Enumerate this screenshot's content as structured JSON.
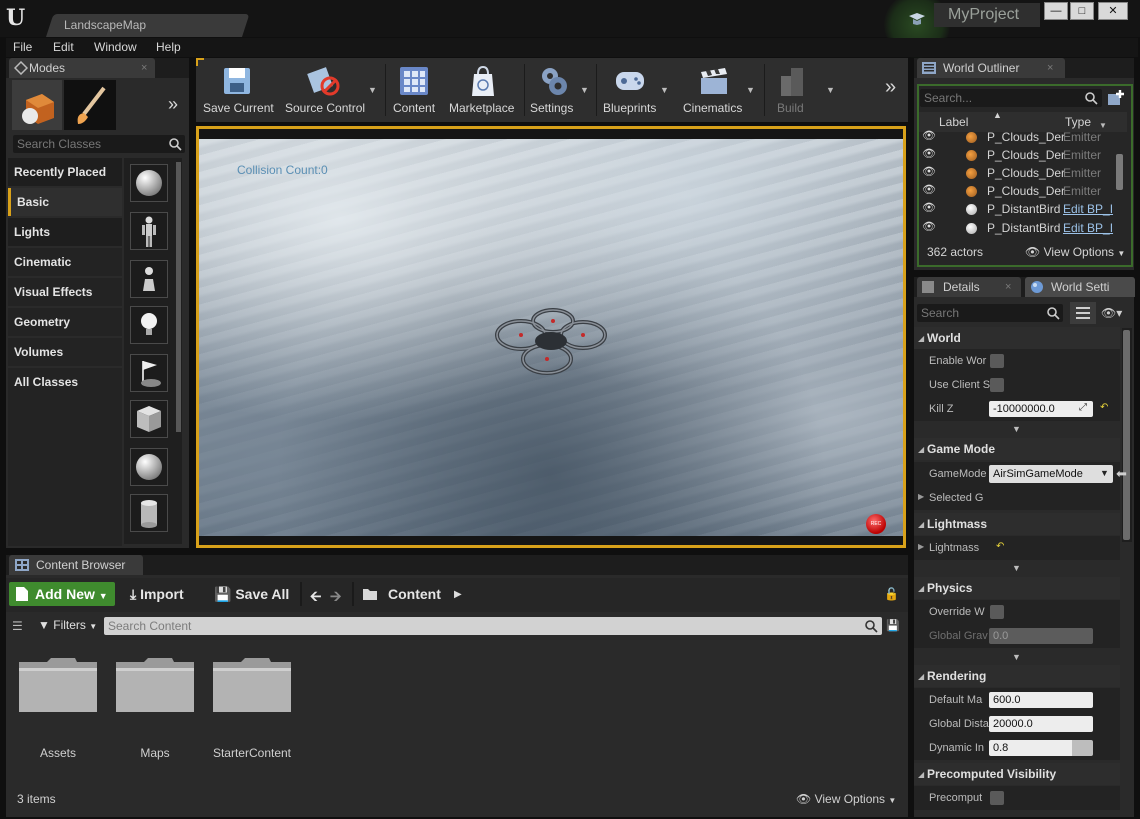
{
  "window": {
    "map_tab": "LandscapeMap",
    "project_name": "MyProject",
    "controls": [
      "minimize",
      "maximize",
      "close"
    ]
  },
  "menu": [
    "File",
    "Edit",
    "Window",
    "Help"
  ],
  "modes": {
    "title": "Modes",
    "search_placeholder": "Search Classes",
    "categories": [
      "Recently Placed",
      "Basic",
      "Lights",
      "Cinematic",
      "Visual Effects",
      "Geometry",
      "Volumes",
      "All Classes"
    ],
    "selected_category": "Basic"
  },
  "toolbar": {
    "items": [
      "Save Current",
      "Source Control",
      "Content",
      "Marketplace",
      "Settings",
      "Blueprints",
      "Cinematics",
      "Build"
    ]
  },
  "viewport": {
    "overlay_text": "Collision Count:0",
    "rec_label": "REC"
  },
  "outliner": {
    "title": "World Outliner",
    "search_placeholder": "Search...",
    "col_label": "Label",
    "col_type": "Type",
    "rows": [
      {
        "label": "P_Clouds_Der",
        "type": "Emitter"
      },
      {
        "label": "P_Clouds_Der",
        "type": "Emitter"
      },
      {
        "label": "P_Clouds_Der",
        "type": "Emitter"
      },
      {
        "label": "P_Clouds_Der",
        "type": "Emitter"
      },
      {
        "label": "P_DistantBird",
        "type": "Edit BP_I"
      },
      {
        "label": "P_DistantBird",
        "type": "Edit BP_I"
      }
    ],
    "actor_count": "362 actors",
    "view_options": "View Options"
  },
  "details": {
    "tab_details": "Details",
    "tab_world": "World Setti",
    "search_placeholder": "Search",
    "sections": {
      "world": "World",
      "game_mode": "Game Mode",
      "lightmass": "Lightmass",
      "physics": "Physics",
      "rendering": "Rendering",
      "precomputed": "Precomputed Visibility"
    },
    "props": {
      "enable_world": "Enable Wor",
      "use_client": "Use Client S",
      "kill_z": "Kill Z",
      "kill_z_value": "-10000000.0",
      "gamemode": "GameMode",
      "gamemode_value": "AirSimGameMode",
      "selected": "Selected G",
      "lightmass": "Lightmass",
      "override": "Override W",
      "global_grav": "Global Grav",
      "global_grav_value": "0.0",
      "default_max": "Default Ma",
      "default_max_value": "600.0",
      "global_dist": "Global Dista",
      "global_dist_value": "20000.0",
      "dynamic": "Dynamic In",
      "dynamic_value": "0.8",
      "precompute": "Precomput"
    }
  },
  "content_browser": {
    "title": "Content Browser",
    "add_new": "Add New",
    "import": "Import",
    "save_all": "Save All",
    "path": "Content",
    "filters": "Filters",
    "search_placeholder": "Search Content",
    "folders": [
      "Assets",
      "Maps",
      "StarterContent"
    ],
    "item_count": "3 items",
    "view_options": "View Options"
  },
  "colors": {
    "accent_green": "#3f8b2e",
    "viewport_border": "#d8a11a",
    "link_blue": "#9cc2e8"
  }
}
